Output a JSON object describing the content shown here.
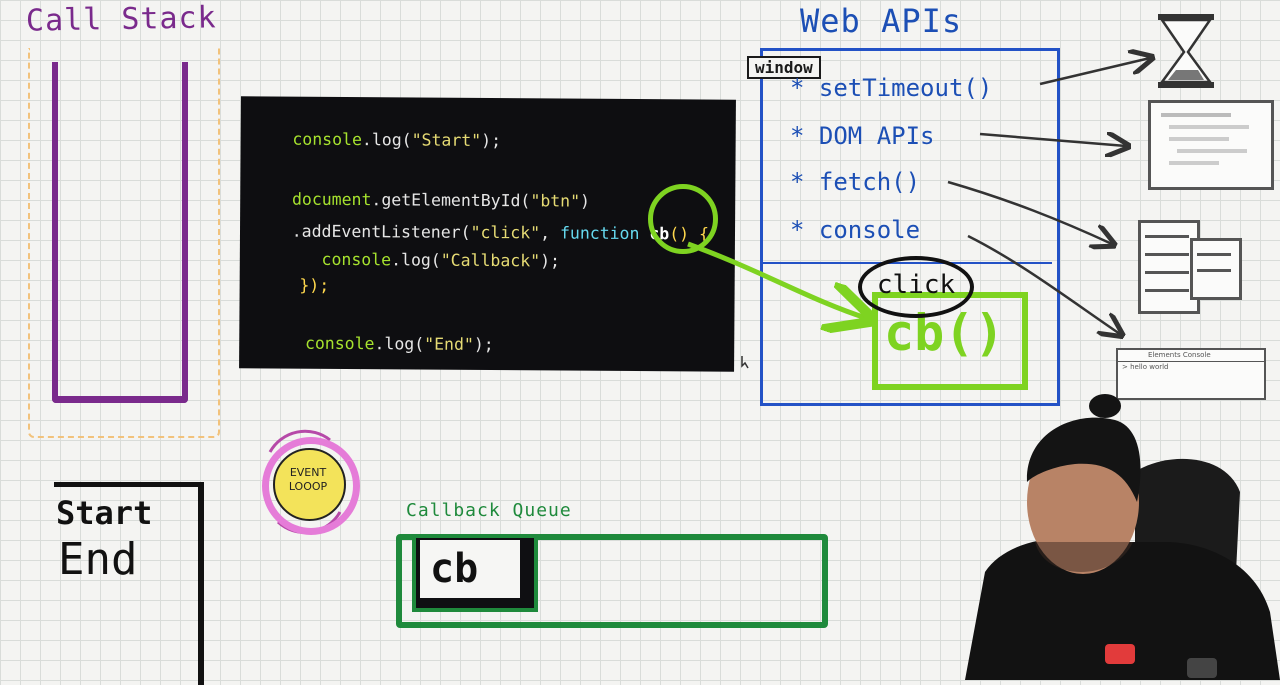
{
  "call_stack": {
    "title": "Call Stack"
  },
  "code": {
    "line1_obj": "console",
    "line1_rest": ".log(",
    "line1_str": "\"Start\"",
    "line1_end": ");",
    "line2_obj": "document",
    "line2_rest": ".getElementById(",
    "line2_str": "\"btn\"",
    "line2_end": ")",
    "line3_rest": ".addEventListener(",
    "line3_str": "\"click\"",
    "line3_comma": ", ",
    "line3_kw": "function",
    "line3_cb": "cb",
    "line3_paren": "()",
    "line3_brace": " {",
    "line4_obj": "console",
    "line4_rest": ".log(",
    "line4_str": "\"Callback\"",
    "line4_end": ");",
    "line5_close": "});",
    "line6_obj": "console",
    "line6_rest": ".log(",
    "line6_str": "\"End\"",
    "line6_end": ");"
  },
  "web_apis": {
    "title": "Web APIs",
    "window_tag": "window",
    "items": [
      "* setTimeout()",
      "* DOM APIs",
      "* fetch()",
      "* console"
    ],
    "click_label": "click",
    "callback_label": "cb()"
  },
  "event_loop": {
    "line1": "EVENT",
    "line2": "LOOOP"
  },
  "output": {
    "line1": "Start",
    "line2": "End"
  },
  "callback_queue": {
    "title": "Callback Queue",
    "item": "cb"
  },
  "sketches": {
    "console_tabs": "Elements   Console",
    "console_output": "> hello world"
  },
  "colors": {
    "call_stack": "#7a2a8c",
    "web_apis": "#2352c6",
    "callback_green": "#7ed321",
    "queue_green": "#1f8a3c",
    "event_loop_pink": "#e57cd8",
    "event_loop_yellow": "#f3e35a"
  }
}
